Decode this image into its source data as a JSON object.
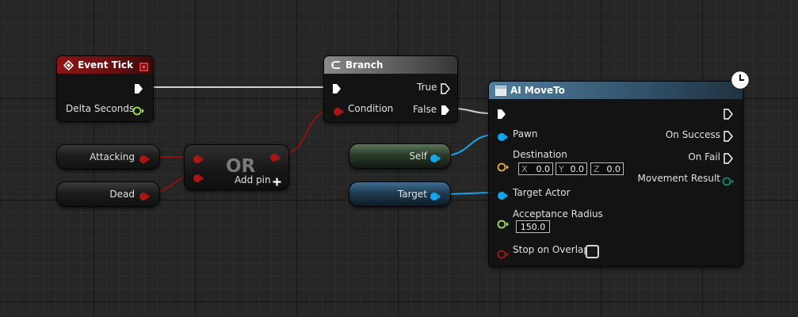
{
  "event_tick": {
    "title": "Event Tick",
    "delta_label": "Delta Seconds"
  },
  "branch": {
    "title": "Branch",
    "condition_label": "Condition",
    "true_label": "True",
    "false_label": "False"
  },
  "or_node": {
    "title": "OR",
    "add_pin_label": "Add pin"
  },
  "variables": {
    "attacking": "Attacking",
    "dead": "Dead",
    "self": "Self",
    "target": "Target"
  },
  "ai_moveto": {
    "title": "AI MoveTo",
    "pawn_label": "Pawn",
    "destination_label": "Destination",
    "dest_x_axis": "X",
    "dest_x": "0.0",
    "dest_y_axis": "Y",
    "dest_y": "0.0",
    "dest_z_axis": "Z",
    "dest_z": "0.0",
    "target_actor_label": "Target Actor",
    "acceptance_radius_label": "Acceptance Radius",
    "acceptance_radius": "150.0",
    "stop_on_overlap_label": "Stop on Overlap",
    "on_success_label": "On Success",
    "on_fail_label": "On Fail",
    "movement_result_label": "Movement Result"
  },
  "colors": {
    "exec": "#ffffff",
    "bool_pin": "#a81616",
    "float_pin": "#9de84a",
    "object_pin": "#12a6ee",
    "vector_pin": "#e8b530",
    "enum_pin": "#0a8a78"
  },
  "icons": {
    "event": "event-diamond-icon",
    "branch": "branch-icon",
    "ai_moveto": "function-icon",
    "latent": "clock-icon"
  }
}
